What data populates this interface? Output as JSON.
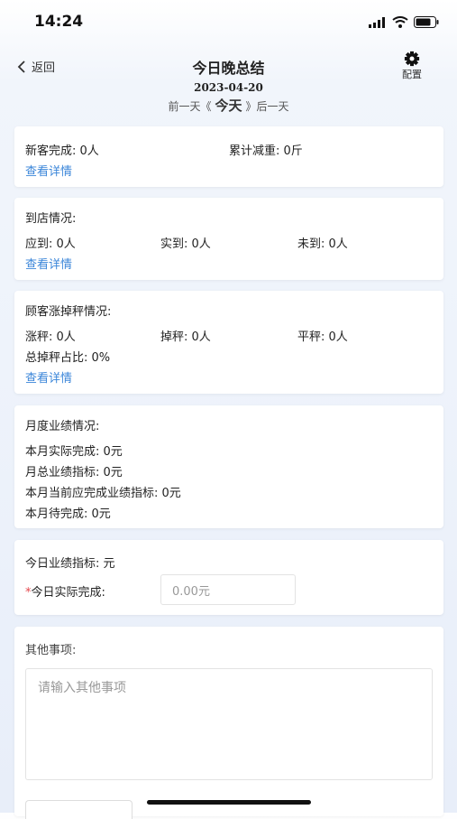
{
  "status_bar": {
    "time": "14:24"
  },
  "nav": {
    "back_label": "返回",
    "title": "今日晚总结",
    "config_label": "配置"
  },
  "date_nav": {
    "date": "2023-04-20",
    "prev_label": "前一天《",
    "today_label": "今天",
    "next_label": "》后一天"
  },
  "new_customers": {
    "completed": "新客完成: 0人",
    "weight_loss": "累计减重: 0斤",
    "details_link": "查看详情"
  },
  "store_visits": {
    "heading": "到店情况:",
    "expected": "应到: 0人",
    "actual": "实到: 0人",
    "absent": "未到: 0人",
    "details_link": "查看详情"
  },
  "weight_changes": {
    "heading": "顾客涨掉秤情况:",
    "gain": "涨秤: 0人",
    "loss": "掉秤: 0人",
    "flat": "平秤: 0人",
    "loss_ratio": "总掉秤占比: 0%",
    "details_link": "查看详情"
  },
  "monthly": {
    "heading": "月度业绩情况:",
    "actual": "本月实际完成: 0元",
    "target": "月总业绩指标: 0元",
    "should_complete": "本月当前应完成业绩指标: 0元",
    "pending": "本月待完成: 0元"
  },
  "daily": {
    "target": "今日业绩指标: 元",
    "required_mark": "*",
    "actual_label": "今日实际完成:",
    "actual_placeholder": "0.00元"
  },
  "other": {
    "heading": "其他事项:",
    "placeholder": "请输入其他事项"
  }
}
